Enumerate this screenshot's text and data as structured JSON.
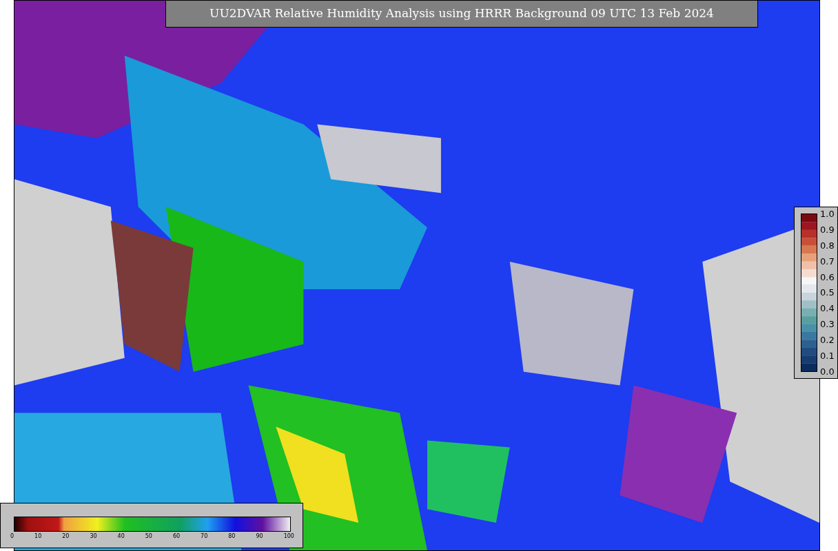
{
  "title": "UU2DVAR Relative Humidity Analysis using HRRR Background 09 UTC 13 Feb 2024",
  "side_colorbar": {
    "ticks": [
      "1.0",
      "0.9",
      "0.8",
      "0.7",
      "0.6",
      "0.5",
      "0.4",
      "0.3",
      "0.2",
      "0.1",
      "0.0"
    ]
  },
  "bottom_colorbar": {
    "ticks": [
      "0",
      "10",
      "20",
      "30",
      "40",
      "50",
      "60",
      "70",
      "80",
      "90",
      "100"
    ]
  }
}
